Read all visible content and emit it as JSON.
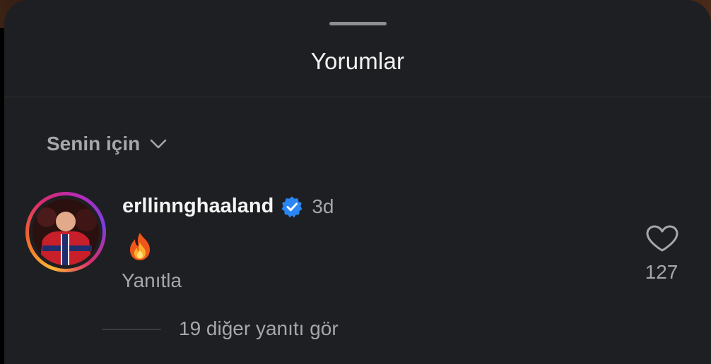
{
  "sheet": {
    "title": "Yorumlar"
  },
  "sort": {
    "label": "Senin için",
    "icon": "chevron-down-icon"
  },
  "comment": {
    "username": "erllinnghaaland",
    "verified": true,
    "verified_color": "#2a86f3",
    "time": "3d",
    "text_emoji": "fire-emoji",
    "reply_label": "Yanıtla",
    "like_icon": "heart-icon",
    "like_count": "127",
    "view_replies": "19 diğer yanıtı gör"
  },
  "colors": {
    "sheet_background": "#1e1f22",
    "primary_text": "#f4f4f4",
    "secondary_text": "#a6a7ab"
  }
}
